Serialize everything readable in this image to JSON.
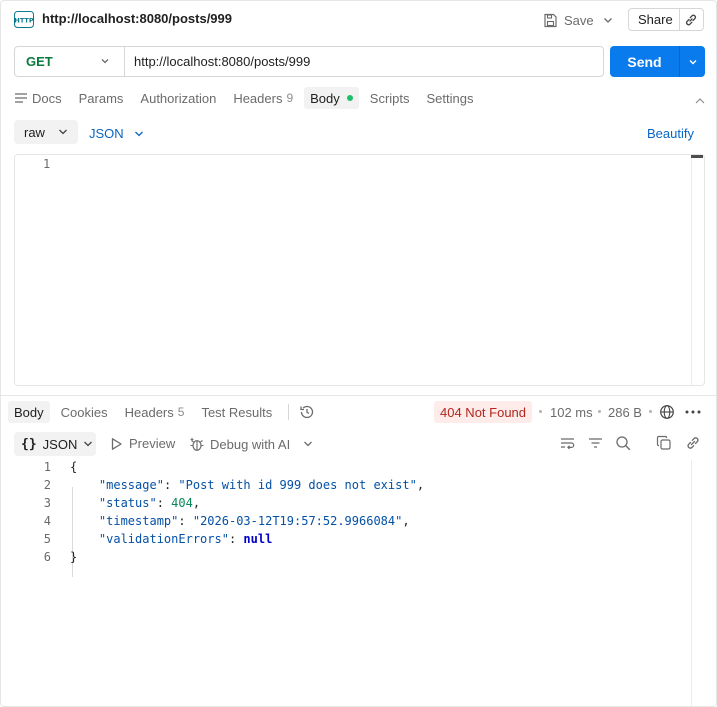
{
  "title": "http://localhost:8080/posts/999",
  "toolbar": {
    "save_label": "Save",
    "share_label": "Share"
  },
  "request": {
    "method": "GET",
    "url": "http://localhost:8080/posts/999",
    "send_label": "Send",
    "tabs": [
      {
        "label": "Docs"
      },
      {
        "label": "Params"
      },
      {
        "label": "Authorization"
      },
      {
        "label": "Headers",
        "count": "9"
      },
      {
        "label": "Body",
        "active": true
      },
      {
        "label": "Scripts"
      },
      {
        "label": "Settings"
      }
    ],
    "body_mode": "raw",
    "body_language": "JSON",
    "beautify_label": "Beautify",
    "editor_line_1": "1"
  },
  "response": {
    "tabs": [
      {
        "label": "Body",
        "active": true
      },
      {
        "label": "Cookies"
      },
      {
        "label": "Headers",
        "count": "5"
      },
      {
        "label": "Test Results"
      }
    ],
    "status": "404 Not Found",
    "time": "102 ms",
    "size": "286 B",
    "format": "JSON",
    "preview_label": "Preview",
    "debug_label": "Debug with AI",
    "lines": [
      {
        "n": "1",
        "open": "{"
      },
      {
        "n": "2",
        "key": "\"message\"",
        "value": "\"Post with id 999 does not exist\"",
        "type": "str",
        "comma": ","
      },
      {
        "n": "3",
        "key": "\"status\"",
        "value": "404",
        "type": "num",
        "comma": ","
      },
      {
        "n": "4",
        "key": "\"timestamp\"",
        "value": "\"2026-03-12T19:57:52.9966084\"",
        "type": "str",
        "comma": ","
      },
      {
        "n": "5",
        "key": "\"validationErrors\"",
        "value": "null",
        "type": "nul",
        "comma": ""
      },
      {
        "n": "6",
        "open": "}"
      }
    ]
  },
  "colors": {
    "accent": "#097bed",
    "method": "#0a7a3d",
    "error_bg": "#fdecea",
    "error_text": "#b3261e",
    "dot": "#1dbf6b"
  }
}
